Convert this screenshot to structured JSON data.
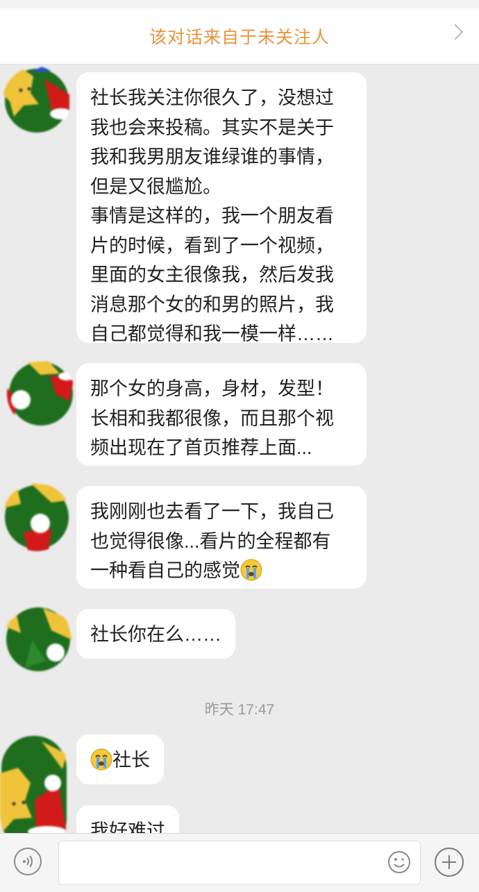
{
  "banner": {
    "text": "该对话来自于未关注人",
    "color": "#e8943a"
  },
  "messages": [
    {
      "lines": [
        "社长我关注你很久了，没想过",
        "我也会来投稿。其实不是关于",
        "我和我男朋友谁绿谁的事情，",
        "但是又很尴尬。",
        "事情是这样的，我一个朋友看",
        "片的时候，看到了一个视频，",
        "里面的女主很像我，然后发我",
        "消息那个女的和男的照片，我",
        "自己都觉得和我一模一样……"
      ]
    },
    {
      "lines": [
        "那个女的身高，身材，发型！",
        "长相和我都很像，而且那个视",
        "频出现在了首页推荐上面..."
      ]
    },
    {
      "lines": [
        "我刚刚也去看了一下，我自己",
        "也觉得很像...看片的全程都有",
        "一种看自己的感觉"
      ],
      "emoji": "crying-face"
    },
    {
      "lines": [
        "社长你在么……"
      ]
    },
    {
      "text": "社长",
      "emoji": "crying-face"
    },
    {
      "lines": [
        "我好难过"
      ]
    }
  ],
  "timestamp": "昨天 17:47",
  "input": {
    "value": "",
    "voice_icon": "voice-icon",
    "emoji_icon": "smiley-icon",
    "more_icon": "plus-icon"
  },
  "colors": {
    "background": "#ebebeb",
    "bubble": "#ffffff",
    "text": "#222222"
  }
}
